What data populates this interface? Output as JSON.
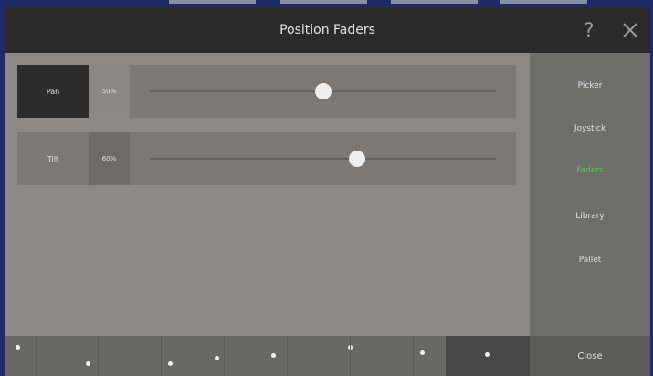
{
  "window": {
    "title": "Position Faders",
    "help_label": "?"
  },
  "faders": [
    {
      "label": "Pan",
      "value": "50%",
      "level": 0.5
    },
    {
      "label": "Tilt",
      "value": "60%",
      "level": 0.6
    }
  ],
  "sidebar": {
    "items": [
      {
        "label": "Picker",
        "active": false
      },
      {
        "label": "Joystick",
        "active": false
      },
      {
        "label": "Faders",
        "active": true
      },
      {
        "label": "Library",
        "active": false
      },
      {
        "label": "Pallet",
        "active": false
      }
    ]
  },
  "bottom": {
    "close_label": "Close"
  },
  "colors": {
    "active_nav": "#4fd24a",
    "inactive_nav": "#e0e0e0"
  }
}
